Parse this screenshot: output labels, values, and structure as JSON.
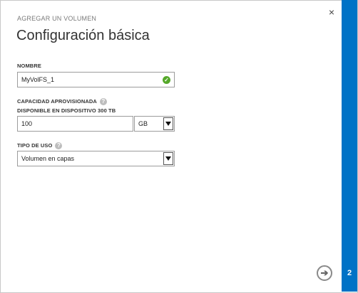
{
  "dialog": {
    "subtitle": "AGREGAR UN VOLUMEN",
    "title": "Configuración básica",
    "close_glyph": "×"
  },
  "form": {
    "name": {
      "label": "NOMBRE",
      "value": "MyVolFS_1",
      "status_icon": "check-icon",
      "status_glyph": "✓",
      "status_color": "#55a82a"
    },
    "capacity": {
      "label": "CAPACIDAD APROVISIONADA",
      "sublabel": "DISPONIBLE EN DISPOSITIVO 300 TB",
      "help_glyph": "?",
      "value": "100",
      "unit_selected": "GB"
    },
    "usage": {
      "label": "TIPO DE USO",
      "help_glyph": "?",
      "selected": "Volumen en capas"
    }
  },
  "footer": {
    "next_glyph": "➔",
    "step_number": "2",
    "accent_color": "#0072c6"
  }
}
